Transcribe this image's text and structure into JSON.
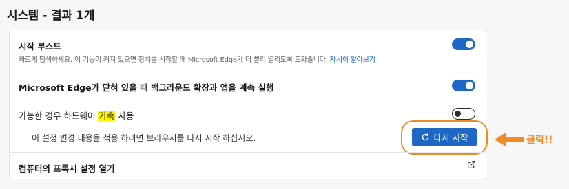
{
  "page": {
    "title": "시스템 - 결과 1개"
  },
  "settings": {
    "startup_boost": {
      "title": "시작 부스트",
      "description": "빠르게 탐색하세요. 이 기능이 켜져 있으면 장치를 시작할 때 Microsoft Edge가 더 빨리 열리도록 도와줍니다.",
      "link": "자세히 알아보기",
      "enabled": true
    },
    "background_apps": {
      "title": "Microsoft Edge가 닫혀 있을 때 백그라운드 확장과 앱을 계속 실행",
      "enabled": true
    },
    "hardware_accel": {
      "title_before": "가능한 경우 하드웨어 ",
      "title_highlight": "가속",
      "title_after": " 사용",
      "enabled": false,
      "restart_message": "이 설정 변경 내용을 적용 하려면 브라우저를 다시 시작 하십시오.",
      "restart_button": "다시 시작"
    },
    "proxy": {
      "title": "컴퓨터의 프록시 설정 열기"
    }
  },
  "annotation": {
    "label": "클릭!!",
    "color": "#f08a24"
  },
  "icons": {
    "restart": "refresh-icon",
    "external": "external-link-icon"
  }
}
